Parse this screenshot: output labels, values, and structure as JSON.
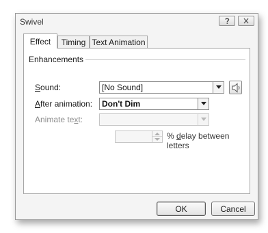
{
  "window": {
    "title": "Swivel"
  },
  "titlebar": {
    "help_icon": "question-mark-icon",
    "close_icon": "close-x-icon"
  },
  "tabs": [
    {
      "label": "Effect",
      "active": true
    },
    {
      "label": "Timing",
      "active": false
    },
    {
      "label": "Text Animation",
      "active": false
    }
  ],
  "enhancements": {
    "group_label": "Enhancements",
    "sound": {
      "label_pre": "",
      "label_u": "S",
      "label_post": "ound:",
      "value": "[No Sound]",
      "icon": "speaker-icon"
    },
    "after_animation": {
      "label_pre": "",
      "label_u": "A",
      "label_post": "fter animation:",
      "value": "Don't Dim"
    },
    "animate_text": {
      "label_pre": "Animate te",
      "label_u": "x",
      "label_post": "t:",
      "value": "",
      "enabled": false
    },
    "delay": {
      "value": "",
      "label_pre": "% ",
      "label_u": "d",
      "label_post": "elay between letters",
      "enabled": false
    }
  },
  "footer": {
    "ok_label": "OK",
    "cancel_label": "Cancel"
  },
  "colors": {
    "dialog_bg": "#f4f4f4",
    "panel_bg": "#ffffff",
    "border": "#a6a6a6",
    "disabled_text": "#8d8d8d"
  }
}
